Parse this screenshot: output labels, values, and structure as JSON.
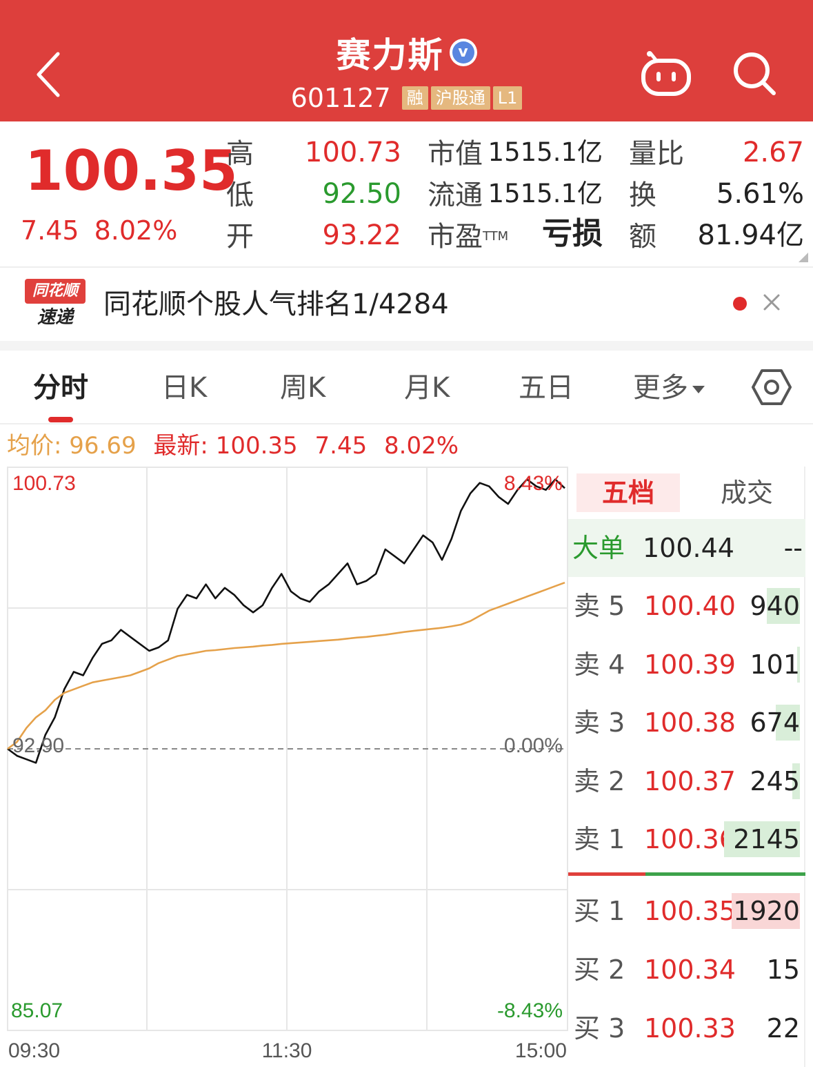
{
  "header": {
    "stock_name": "赛力斯",
    "verified_badge": "v",
    "stock_code": "601127",
    "tags": [
      "融",
      "沪股通",
      "L1"
    ],
    "icons": [
      "back-chevron-icon",
      "robot-assistant-icon",
      "search-icon"
    ],
    "bg_color": "#dd3f3c"
  },
  "quote": {
    "price": "100.35",
    "change": "7.45",
    "change_pct": "8.02%",
    "high_label": "高",
    "high": "100.73",
    "low_label": "低",
    "low": "92.50",
    "open_label": "开",
    "open": "93.22",
    "mktcap_label": "市值",
    "mktcap": "1515.1亿",
    "float_label": "流通",
    "float": "1515.1亿",
    "pe_label": "市盈",
    "pe_sup": "TTM",
    "pe": "亏损",
    "volratio_label": "量比",
    "volratio": "2.67",
    "turnover_label": "换",
    "turnover": "5.61%",
    "amount_label": "额",
    "amount": "81.94亿"
  },
  "banner": {
    "logo_top": "同花顺",
    "logo_bottom": "速递",
    "text": "同花顺个股人气排名1/4284"
  },
  "tabs": [
    {
      "label": "分时",
      "active": true
    },
    {
      "label": "日K"
    },
    {
      "label": "周K"
    },
    {
      "label": "月K"
    },
    {
      "label": "五日"
    },
    {
      "label": "更多"
    }
  ],
  "info_line": {
    "avg_label": "均价:",
    "avg": "96.69",
    "latest_label": "最新:",
    "latest": "100.35",
    "change": "7.45",
    "change_pct": "8.02%"
  },
  "chart_data": {
    "type": "line",
    "y_max_label": "100.73",
    "y_mid_label": "92.90",
    "y_min_label": "85.07",
    "pct_max_label": "8.43%",
    "pct_mid_label": "0.00%",
    "pct_min_label": "-8.43%",
    "x_labels": [
      "09:30",
      "11:30",
      "15:00"
    ],
    "ylim": [
      85.07,
      100.73
    ],
    "prev_close": 92.9,
    "grid": true,
    "series": [
      {
        "name": "价格",
        "color": "#111111",
        "values": [
          92.9,
          92.7,
          92.6,
          92.5,
          93.3,
          93.8,
          94.6,
          95.1,
          95.0,
          95.5,
          95.9,
          96.0,
          96.3,
          96.1,
          95.9,
          95.7,
          95.8,
          96.0,
          96.9,
          97.3,
          97.2,
          97.6,
          97.2,
          97.5,
          97.3,
          97.0,
          96.8,
          97.0,
          97.5,
          97.9,
          97.4,
          97.2,
          97.1,
          97.4,
          97.6,
          97.9,
          98.2,
          97.6,
          97.7,
          97.9,
          98.6,
          98.4,
          98.2,
          98.6,
          99.0,
          98.8,
          98.3,
          98.9,
          99.7,
          100.2,
          100.5,
          100.4,
          100.1,
          99.9,
          100.3,
          100.6,
          100.4,
          100.3,
          100.6,
          100.35
        ],
        "values_note_excluded": false
      },
      {
        "name": "均价",
        "color": "#e5a14a",
        "values": [
          92.9,
          93.1,
          93.5,
          93.8,
          94.0,
          94.3,
          94.5,
          94.6,
          94.7,
          94.8,
          94.85,
          94.9,
          94.95,
          95.0,
          95.1,
          95.2,
          95.35,
          95.45,
          95.55,
          95.6,
          95.65,
          95.7,
          95.72,
          95.75,
          95.78,
          95.8,
          95.82,
          95.85,
          95.87,
          95.9,
          95.92,
          95.94,
          95.96,
          95.98,
          96.0,
          96.02,
          96.05,
          96.08,
          96.1,
          96.13,
          96.16,
          96.2,
          96.24,
          96.27,
          96.3,
          96.33,
          96.36,
          96.4,
          96.45,
          96.55,
          96.7,
          96.85,
          96.95,
          97.05,
          97.15,
          97.25,
          97.35,
          97.45,
          97.55,
          97.65
        ]
      }
    ]
  },
  "orderbook": {
    "tab_active": "五档",
    "tab_other": "成交",
    "big_label": "大单",
    "big_price": "100.44",
    "big_vol": "--",
    "sell": [
      {
        "label": "卖 5",
        "price": "100.40",
        "vol": "940",
        "bar": 0.22
      },
      {
        "label": "卖 4",
        "price": "100.39",
        "vol": "101",
        "bar": 0.02
      },
      {
        "label": "卖 3",
        "price": "100.38",
        "vol": "674",
        "bar": 0.16
      },
      {
        "label": "卖 2",
        "price": "100.37",
        "vol": "245",
        "bar": 0.05
      },
      {
        "label": "卖 1",
        "price": "100.36",
        "vol": "2145",
        "bar": 0.5
      }
    ],
    "buy": [
      {
        "label": "买 1",
        "price": "100.35",
        "vol": "1920",
        "bar": 0.45
      },
      {
        "label": "买 2",
        "price": "100.34",
        "vol": "15",
        "bar": 0.0
      },
      {
        "label": "买 3",
        "price": "100.33",
        "vol": "22",
        "bar": 0.0
      }
    ],
    "colors": {
      "red": "#e02b2b",
      "green": "#2a9a2e"
    }
  }
}
